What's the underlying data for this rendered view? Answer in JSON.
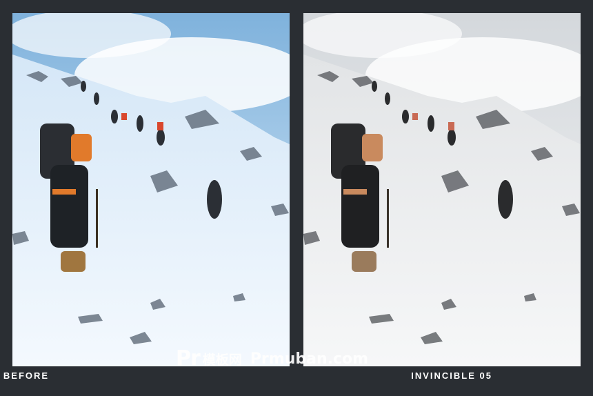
{
  "panels": {
    "before": {
      "caption": "BEFORE"
    },
    "after": {
      "caption": "INVINCIBLE 05"
    }
  },
  "watermark": {
    "logo": "Pr",
    "name": "模板网",
    "domain": "Prmuban.com"
  },
  "colors": {
    "background": "#2a2e33",
    "sky_before": "#8fbfe3",
    "sky_after": "#e8ebee",
    "snow_before": "#e6f1fb",
    "snow_after": "#eceeef"
  }
}
